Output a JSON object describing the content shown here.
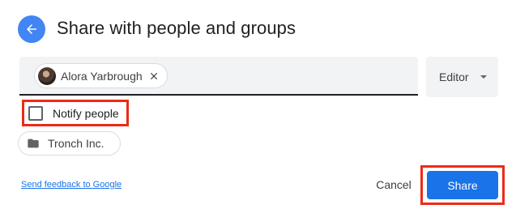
{
  "dialog": {
    "title": "Share with people and groups",
    "back_icon": "arrow-left-icon"
  },
  "recipients": {
    "chips": [
      {
        "name": "Alora Yarbrough",
        "avatar": "avatar-photo",
        "remove_icon": "close-icon"
      }
    ]
  },
  "role": {
    "selected": "Editor",
    "icon": "caret-down-icon"
  },
  "notify": {
    "label": "Notify people",
    "checked": false
  },
  "organization": {
    "label": "Tronch Inc.",
    "icon": "folder-icon"
  },
  "footer": {
    "feedback_link": "Send feedback to Google",
    "cancel_label": "Cancel",
    "share_label": "Share"
  },
  "colors": {
    "accent": "#1a73e8",
    "back_button": "#4285f4",
    "highlight": "#ee2a16",
    "field_bg": "#f1f3f4"
  }
}
